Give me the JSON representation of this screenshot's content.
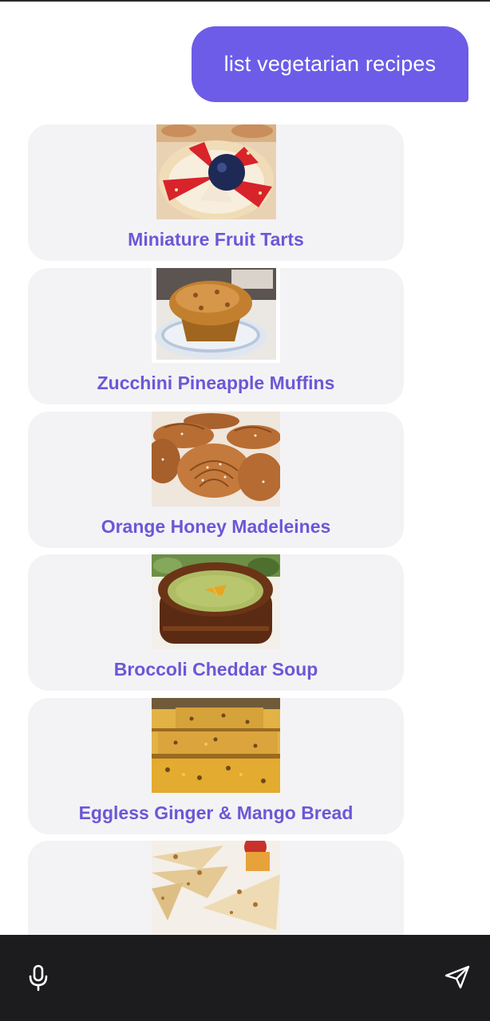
{
  "chat": {
    "user_message": "list vegetarian recipes",
    "recipes": [
      {
        "title": "Miniature Fruit Tarts",
        "image": "fruit-tart-image"
      },
      {
        "title": "Zucchini Pineapple Muffins",
        "image": "muffin-image"
      },
      {
        "title": "Orange Honey Madeleines",
        "image": "madeleine-image"
      },
      {
        "title": "Broccoli Cheddar Soup",
        "image": "soup-image"
      },
      {
        "title": "Eggless Ginger & Mango Bread",
        "image": "bread-image"
      },
      {
        "title": "",
        "image": "quesadilla-image"
      }
    ]
  },
  "input_bar": {
    "mic_icon": "microphone-icon",
    "send_icon": "send-icon"
  },
  "colors": {
    "accent": "#6c5ce7",
    "recipe_title": "#6b58d6",
    "card_bg": "#f3f3f6",
    "bottom_bar": "#1c1c1e"
  }
}
